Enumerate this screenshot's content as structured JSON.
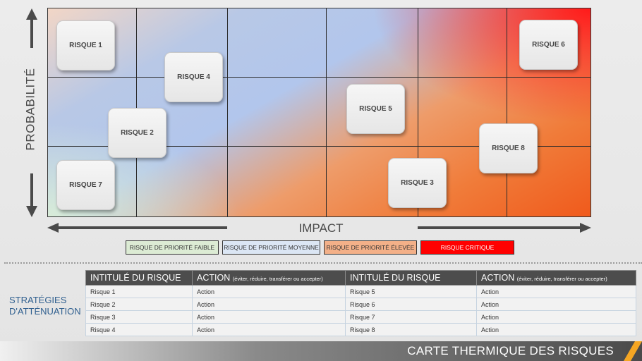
{
  "heatmap": {
    "axis_y_label": "PROBABILITÉ",
    "axis_x_label": "IMPACT",
    "risks": [
      {
        "id": "r1",
        "label": "RISQUE 1"
      },
      {
        "id": "r2",
        "label": "RISQUE 2"
      },
      {
        "id": "r3",
        "label": "RISQUE 3"
      },
      {
        "id": "r4",
        "label": "RISQUE 4"
      },
      {
        "id": "r5",
        "label": "RISQUE 5"
      },
      {
        "id": "r6",
        "label": "RISQUE 6"
      },
      {
        "id": "r7",
        "label": "RISQUE 7"
      },
      {
        "id": "r8",
        "label": "RISQUE 8"
      }
    ]
  },
  "legend": [
    {
      "label": "RISQUE DE PRIORITÉ FAIBLE",
      "color": "#dcebd4"
    },
    {
      "label": "RISQUE DE PRIORITÉ MOYENNE",
      "color": "#dbe6f4"
    },
    {
      "label": "RISQUE DE PRIORITÉ ÉLEVÉE",
      "color": "#f3b088"
    },
    {
      "label": "RISQUE CRITIQUE",
      "color": "#ff0000"
    }
  ],
  "strategies": {
    "label": "STRATÉGIES D'ATTÉNUATION",
    "headers": {
      "title": "INTITULÉ DU RISQUE",
      "action": "ACTION",
      "action_hint": "(éviter, réduire, transférer ou accepter)"
    },
    "rows": [
      [
        "Risque 1",
        "Action",
        "Risque 5",
        "Action"
      ],
      [
        "Risque 2",
        "Action",
        "Risque 6",
        "Action"
      ],
      [
        "Risque 3",
        "Action",
        "Risque 7",
        "Action"
      ],
      [
        "Risque 4",
        "Action",
        "Risque 8",
        "Action"
      ]
    ]
  },
  "footer": {
    "title": "CARTE THERMIQUE DES RISQUES",
    "accent_color": "#f5a623"
  }
}
